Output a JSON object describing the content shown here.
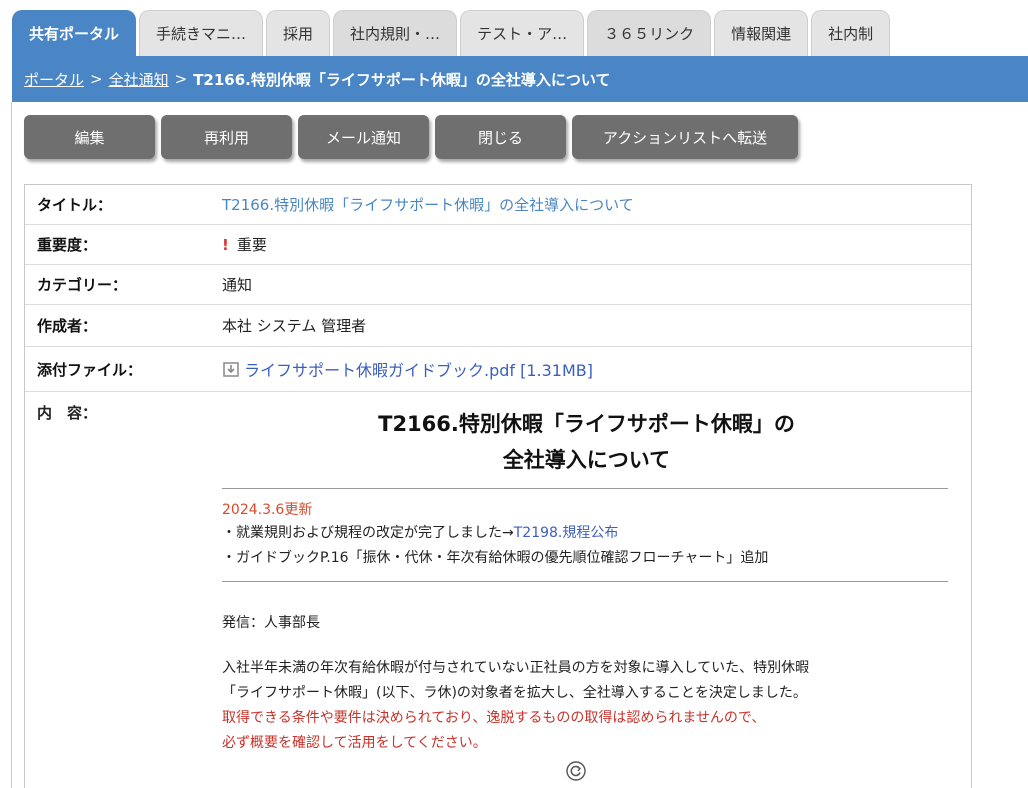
{
  "tabs": [
    {
      "label": "共有ポータル",
      "active": true
    },
    {
      "label": "手続きマニ…",
      "active": false
    },
    {
      "label": "採用",
      "active": false
    },
    {
      "label": "社内規則・…",
      "active": false
    },
    {
      "label": "テスト・ア…",
      "active": false
    },
    {
      "label": "３６５リンク",
      "active": false
    },
    {
      "label": "情報関連",
      "active": false
    },
    {
      "label": "社内制",
      "active": false
    }
  ],
  "breadcrumb": {
    "portal": "ポータル",
    "notices": "全社通知",
    "separator": ">",
    "current": "T2166.特別休暇「ライフサポート休暇」の全社導入について"
  },
  "toolbar": {
    "edit": "編集",
    "reuse": "再利用",
    "mail": "メール通知",
    "close": "閉じる",
    "transfer": "アクションリストへ転送"
  },
  "fields": {
    "title_label": "タイトル：",
    "title_value": "T2166.特別休暇「ライフサポート休暇」の全社導入について",
    "importance_label": "重要度：",
    "importance_mark": "!",
    "importance_value": "重要",
    "category_label": "カテゴリー：",
    "category_value": "通知",
    "author_label": "作成者：",
    "author_value": "本社 システム 管理者",
    "attachment_label": "添付ファイル：",
    "attachment_value": "ライフサポート休暇ガイドブック.pdf [1.31MB]",
    "content_label": "内　容："
  },
  "content": {
    "title_line1": "T2166.特別休暇「ライフサポート休暇」の",
    "title_line2": "全社導入について",
    "updated": "2024.3.6更新",
    "bullet1_text": "・就業規則および規程の改定が完了しました→",
    "bullet1_link": "T2198.規程公布",
    "bullet2": "・ガイドブックP.16「振休・代休・年次有給休暇の優先順位確認フローチャート」追加",
    "sender": "発信：人事部長",
    "para1_line1": "入社半年未満の年次有給休暇が付与されていない正社員の方を対象に導入していた、特別休暇",
    "para1_line2": "「ライフサポート休暇」(以下、ラ休)の対象者を拡大し、全社導入することを決定しました。",
    "para2_line1": "取得できる条件や要件は決められており、逸脱するものの取得は認められませんので、",
    "para2_line2": "必ず概要を確認して活用をしてください。"
  },
  "colors": {
    "accent": "#4a86c5",
    "button": "#6f6f6f",
    "updated_red": "#d9492a",
    "link_blue": "#3b5fc0"
  },
  "icons": {
    "download": "download-icon",
    "refresh": "refresh-icon"
  }
}
